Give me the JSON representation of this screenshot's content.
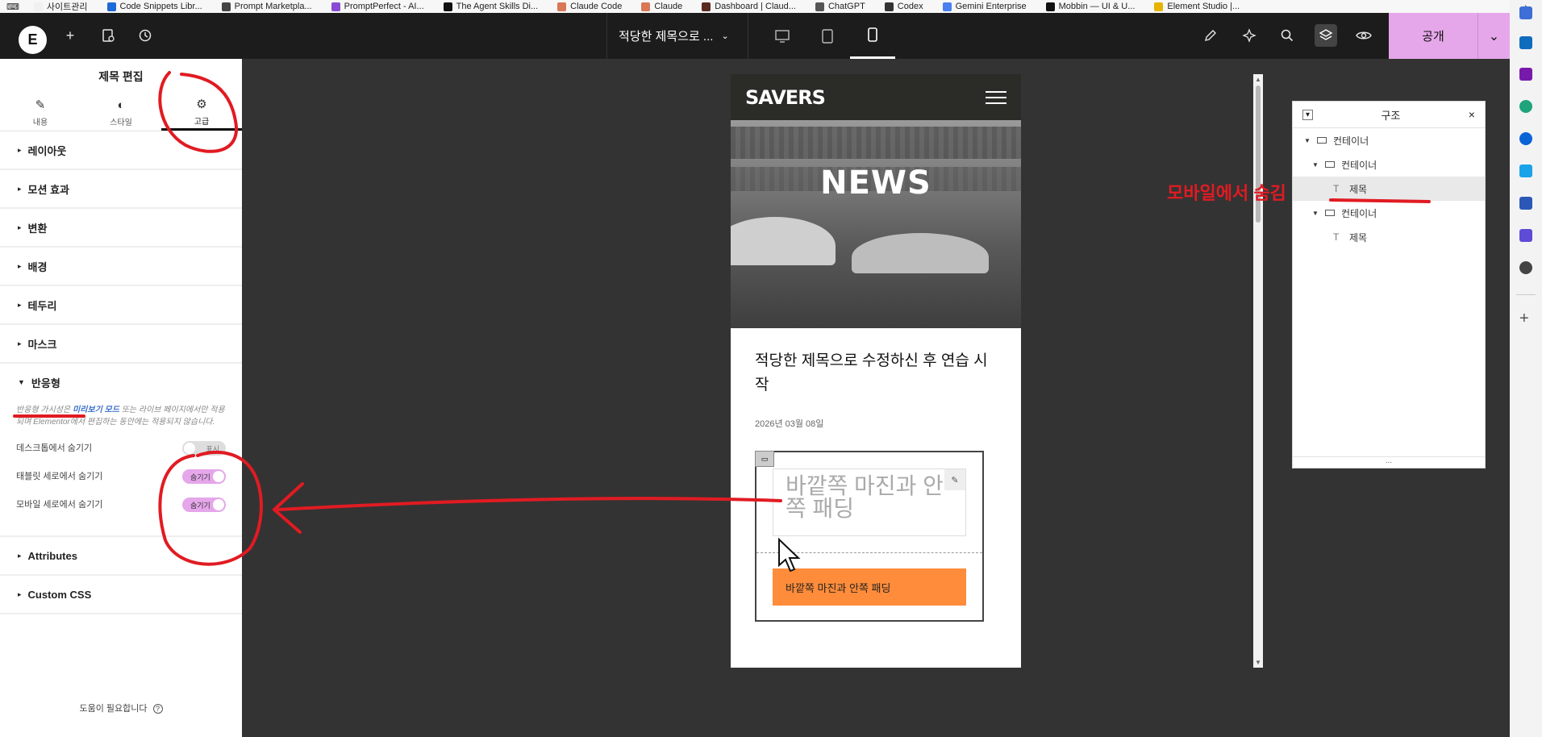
{
  "bookmarks": [
    {
      "label": "사이트관리",
      "color": "#f1f1f1",
      "icon": "folder-icon"
    },
    {
      "label": "Code Snippets Libr...",
      "color": "#1d6ad8",
      "icon": "code-icon"
    },
    {
      "label": "Prompt Marketpla...",
      "color": "#444444",
      "icon": "prompt-icon"
    },
    {
      "label": "PromptPerfect - AI...",
      "color": "#8a4bd4",
      "icon": "perfect-icon"
    },
    {
      "label": "The Agent Skills Di...",
      "color": "#111111",
      "icon": "triangle-icon"
    },
    {
      "label": "Claude Code",
      "color": "#d97757",
      "icon": "claude-icon"
    },
    {
      "label": "Claude",
      "color": "#d97757",
      "icon": "claude-icon"
    },
    {
      "label": "Dashboard | Claud...",
      "color": "#5a2a20",
      "icon": "dashboard-icon"
    },
    {
      "label": "ChatGPT",
      "color": "#555555",
      "icon": "chatgpt-icon"
    },
    {
      "label": "Codex",
      "color": "#333333",
      "icon": "codex-icon"
    },
    {
      "label": "Gemini Enterprise",
      "color": "#4a7ff0",
      "icon": "gemini-icon"
    },
    {
      "label": "Mobbin — UI & U...",
      "color": "#111111",
      "icon": "mobbin-icon"
    },
    {
      "label": "Element Studio |...",
      "color": "#e6b400",
      "icon": "element-icon"
    }
  ],
  "topbar": {
    "doc_title": "적당한 제목으로 ...",
    "publish_label": "공개"
  },
  "panel": {
    "title": "제목 편집",
    "tabs": [
      {
        "label": "내용",
        "icon": "pencil-icon",
        "glyph": "✎"
      },
      {
        "label": "스타일",
        "icon": "contrast-icon",
        "glyph": "◐"
      },
      {
        "label": "고급",
        "icon": "gear-icon",
        "glyph": "⚙"
      }
    ],
    "sections_top": [
      "레이아웃",
      "모션 효과",
      "변환",
      "배경",
      "테두리",
      "마스크"
    ],
    "responsive": {
      "label": "반응형",
      "note_prefix": "반응형 가시성은 ",
      "note_link": "미리보기 모드",
      "note_suffix": " 또는 라이브 페이지에서만 적용되며 Elementor에서 편집하는 동안에는 적용되지 않습니다.",
      "toggles": [
        {
          "label": "데스크톱에서 숨기기",
          "state": "표시",
          "on": false
        },
        {
          "label": "태블릿 세로에서 숨기기",
          "state": "숨기기",
          "on": true
        },
        {
          "label": "모바일 세로에서 숨기기",
          "state": "숨기기",
          "on": true
        }
      ]
    },
    "sections_bottom": [
      "Attributes",
      "Custom CSS"
    ],
    "help": "도움이 필요합니다"
  },
  "preview": {
    "brand": "SAVERS",
    "hero_text": "NEWS",
    "article_title": "적당한 제목으로 수정하신 후 연습 시작",
    "date": "2026년 03월 08일",
    "ghost_heading": "바깥쪽 마진과 안쪽 패딩",
    "cta_label": "바깥쪽 마진과 안쪽 패딩"
  },
  "structure": {
    "title": "구조",
    "nodes": [
      {
        "label": "컨테이너",
        "depth": 0,
        "kind": "container",
        "expanded": true
      },
      {
        "label": "컨테이너",
        "depth": 1,
        "kind": "container",
        "expanded": true
      },
      {
        "label": "제목",
        "depth": 2,
        "kind": "heading",
        "selected": true
      },
      {
        "label": "컨테이너",
        "depth": 1,
        "kind": "container",
        "expanded": true
      },
      {
        "label": "제목",
        "depth": 2,
        "kind": "heading"
      }
    ],
    "footer": "..."
  },
  "annotation": {
    "text": "모바일에서 숨김",
    "color": "#e11b22"
  },
  "colors": {
    "accent_pink": "#e6a7ea",
    "cta_orange": "#ff8c3a",
    "toolbar_dark": "#1c1c1c"
  }
}
